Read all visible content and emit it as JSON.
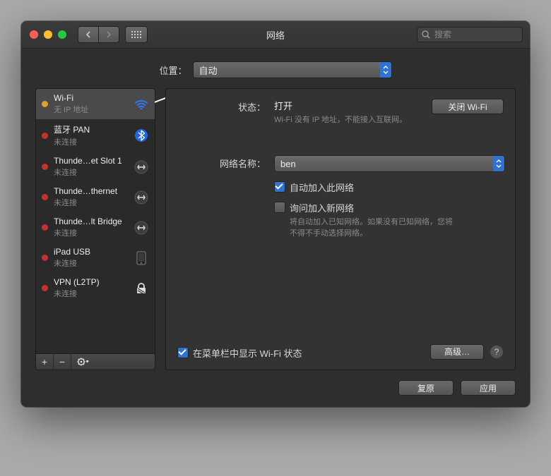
{
  "window": {
    "title": "网络",
    "search_placeholder": "搜索"
  },
  "location": {
    "label": "位置：",
    "value": "自动"
  },
  "sidebar": {
    "items": [
      {
        "name": "Wi-Fi",
        "status": "无 IP 地址",
        "icon": "wifi",
        "dot": "yellow",
        "selected": true
      },
      {
        "name": "蓝牙 PAN",
        "status": "未连接",
        "icon": "bluetooth",
        "dot": "red",
        "selected": false
      },
      {
        "name": "Thunde…et Slot 1",
        "status": "未连接",
        "icon": "tbolt",
        "dot": "red",
        "selected": false
      },
      {
        "name": "Thunde…thernet",
        "status": "未连接",
        "icon": "tbolt",
        "dot": "red",
        "selected": false
      },
      {
        "name": "Thunde…lt Bridge",
        "status": "未连接",
        "icon": "tbolt",
        "dot": "red",
        "selected": false
      },
      {
        "name": "iPad USB",
        "status": "未连接",
        "icon": "ipad",
        "dot": "red",
        "selected": false
      },
      {
        "name": "VPN (L2TP)",
        "status": "未连接",
        "icon": "lock",
        "dot": "red",
        "selected": false
      }
    ]
  },
  "detail": {
    "status_label": "状态：",
    "status_value": "打开",
    "status_sub": "Wi-Fi 没有 IP 地址，不能接入互联网。",
    "toggle_wifi_btn": "关闭 Wi-Fi",
    "network_name_label": "网络名称：",
    "network_name_value": "ben",
    "auto_join_label": "自动加入此网络",
    "auto_join_checked": true,
    "ask_join_label": "询问加入新网络",
    "ask_join_checked": false,
    "ask_join_sub": "将自动加入已知网络。如果没有已知网络，您将不得不手动选择网络。",
    "menubar_label": "在菜单栏中显示 Wi-Fi 状态",
    "menubar_checked": true,
    "advanced_btn": "高级…"
  },
  "footer": {
    "revert_btn": "复原",
    "apply_btn": "应用"
  }
}
